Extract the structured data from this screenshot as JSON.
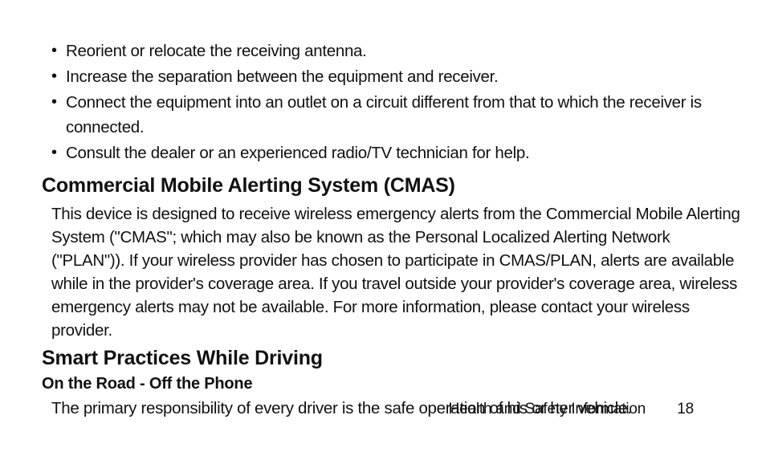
{
  "bullets": [
    "Reorient or relocate the receiving antenna.",
    "Increase the separation between the equipment and receiver.",
    "Connect the equipment into an outlet on a circuit different from that to which the receiver is connected.",
    "Consult the dealer or an experienced radio/TV technician for help."
  ],
  "sections": {
    "cmas": {
      "heading": "Commercial Mobile Alerting System (CMAS)",
      "body": "This device is designed to receive wireless emergency alerts from the Commercial Mobile Alerting System (\"CMAS\"; which may also be known as the Personal Localized Alerting Network (\"PLAN\")). If your wireless provider has chosen to participate in CMAS/PLAN, alerts are available while in the provider's coverage area. If you travel outside your provider's coverage area, wireless emergency alerts may not be available. For more information, please contact your wireless provider."
    },
    "driving": {
      "heading": "Smart Practices While Driving",
      "subheading": "On the Road - Off the Phone",
      "body": "The primary responsibility of every driver is the safe operation of his or her vehicle."
    }
  },
  "footer": {
    "section_title": "Health and Safety Information",
    "page_number": "18"
  }
}
